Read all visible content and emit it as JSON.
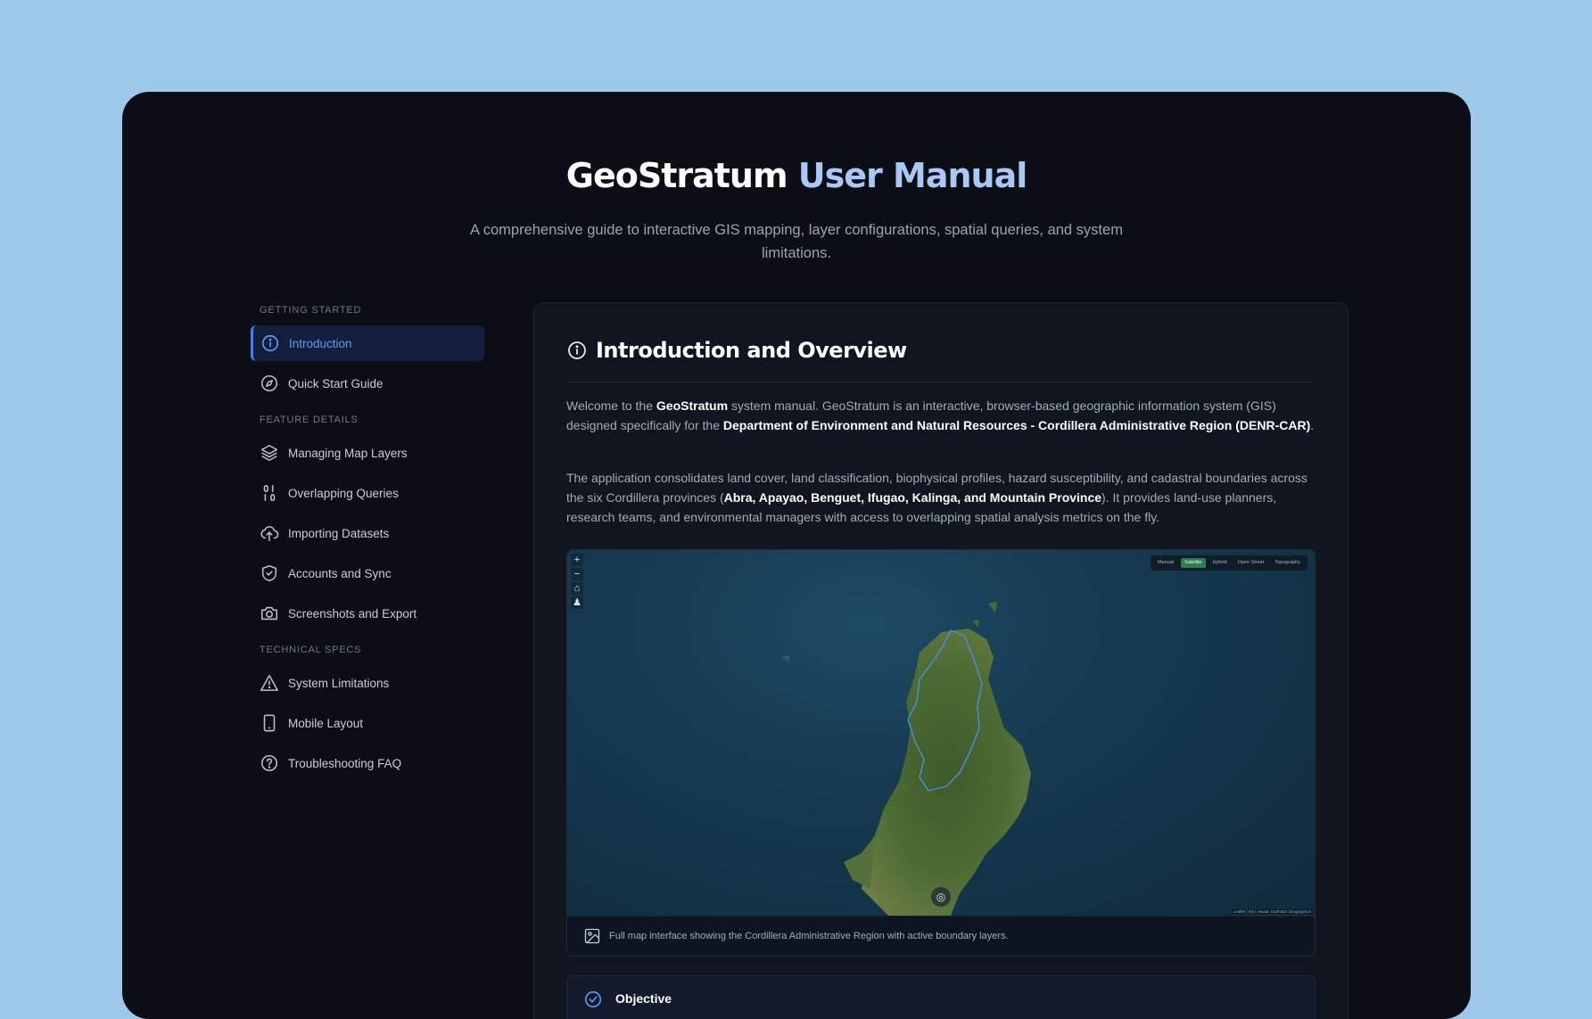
{
  "header": {
    "title_main": "GeoStratum",
    "title_accent": "User Manual",
    "subtitle": "A comprehensive guide to interactive GIS mapping, layer configurations, spatial queries, and system limitations."
  },
  "sidebar": {
    "sections": [
      {
        "heading": "GETTING STARTED",
        "items": [
          {
            "label": "Introduction",
            "icon": "info-icon",
            "active": true
          },
          {
            "label": "Quick Start Guide",
            "icon": "compass-icon"
          }
        ]
      },
      {
        "heading": "FEATURE DETAILS",
        "items": [
          {
            "label": "Managing Map Layers",
            "icon": "layers-icon"
          },
          {
            "label": "Overlapping Queries",
            "icon": "binary-icon"
          },
          {
            "label": "Importing Datasets",
            "icon": "cloud-upload-icon"
          },
          {
            "label": "Accounts and Sync",
            "icon": "shield-check-icon"
          },
          {
            "label": "Screenshots and Export",
            "icon": "camera-icon"
          }
        ]
      },
      {
        "heading": "TECHNICAL SPECS",
        "items": [
          {
            "label": "System Limitations",
            "icon": "warning-icon"
          },
          {
            "label": "Mobile Layout",
            "icon": "smartphone-icon"
          },
          {
            "label": "Troubleshooting FAQ",
            "icon": "help-circle-icon"
          }
        ]
      }
    ]
  },
  "main": {
    "heading": "Introduction and Overview",
    "p1": {
      "t1": "Welcome to the ",
      "b1": "GeoStratum",
      "t2": " system manual. GeoStratum is an interactive, browser-based geographic information system (GIS) designed specifically for the ",
      "b2": "Department of Environment and Natural Resources - Cordillera Administrative Region (DENR-CAR)",
      "t3": "."
    },
    "p2": {
      "t1": "The application consolidates land cover, land classification, biophysical profiles, hazard susceptibility, and cadastral boundaries across the six Cordillera provinces (",
      "b1": "Abra, Apayao, Benguet, Ifugao, Kalinga, and Mountain Province",
      "t2": "). It provides land-use planners, research teams, and environmental managers with access to overlapping spatial analysis metrics on the fly."
    },
    "figure": {
      "zoom_in": "+",
      "zoom_out": "−",
      "home": "⌂",
      "person": "♟",
      "basemaps": [
        "Manual",
        "Satellite",
        "Hybrid",
        "Open Street",
        "Topography"
      ],
      "selected_basemap": "Satellite",
      "attribution": "Leaflet | Esri, Maxar, Earthstar Geographics",
      "locate": "◎",
      "caption": "Full map interface showing the Cordillera Administrative Region with active boundary layers."
    },
    "objective": {
      "label": "Objective"
    }
  },
  "colors": {
    "accent": "#3b82f6",
    "active_text": "#5f9cf4",
    "title_accent": "#a8c8f6",
    "page_bg": "#9dc8ea",
    "window_bg": "#0b0e15"
  }
}
